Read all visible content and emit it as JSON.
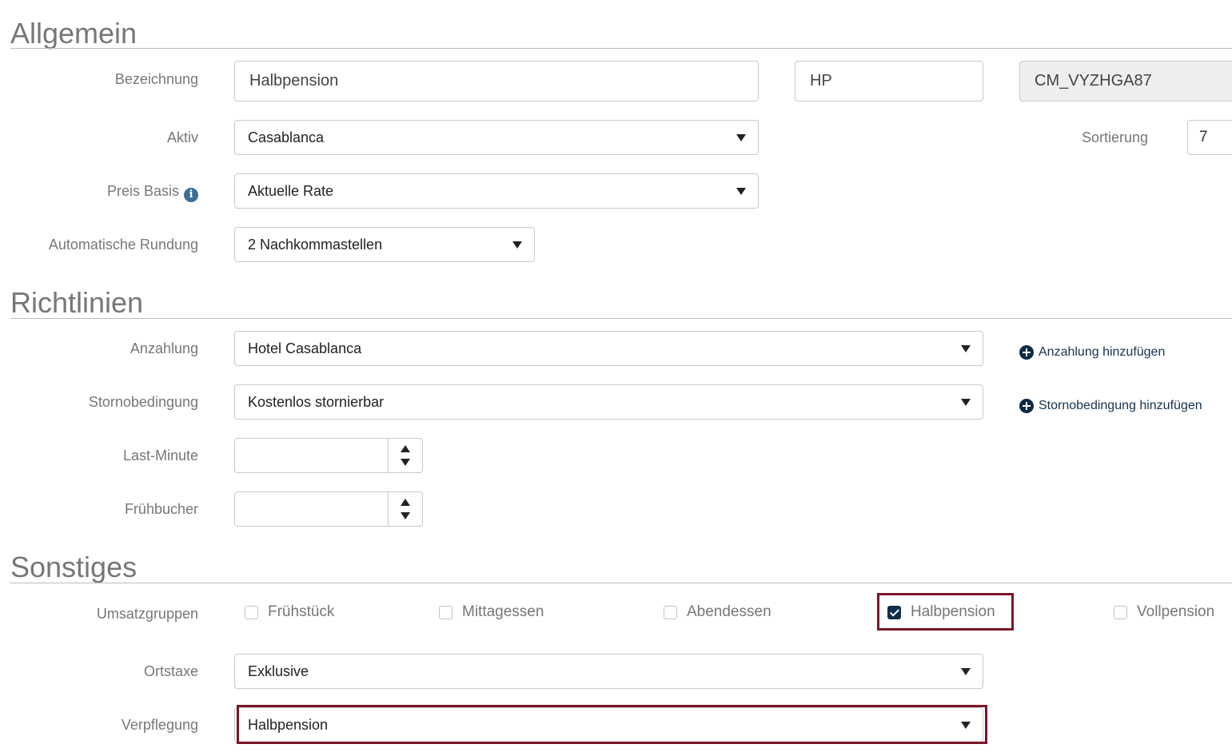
{
  "sections": {
    "allgemein": "Allgemein",
    "richtlinien": "Richtlinien",
    "sonstiges": "Sonstiges"
  },
  "allgemein": {
    "bezeichnung_label": "Bezeichnung",
    "bezeichnung_value": "Halbpension",
    "kurz_value": "HP",
    "code_value": "CM_VYZHGA87",
    "aktiv_label": "Aktiv",
    "aktiv_value": "Casablanca",
    "sortierung_label": "Sortierung",
    "sortierung_value": "7",
    "preis_basis_label": "Preis Basis",
    "preis_basis_value": "Aktuelle Rate",
    "rundung_label": "Automatische Rundung",
    "rundung_value": "2 Nachkommastellen"
  },
  "richtlinien": {
    "anzahlung_label": "Anzahlung",
    "anzahlung_value": "Hotel Casablanca",
    "anzahlung_add": "Anzahlung hinzufügen",
    "storno_label": "Stornobedingung",
    "storno_value": "Kostenlos stornierbar",
    "storno_add": "Stornobedingung hinzufügen",
    "lastminute_label": "Last-Minute",
    "lastminute_value": "",
    "fruehbucher_label": "Frühbucher",
    "fruehbucher_value": ""
  },
  "sonstiges": {
    "umsatzgruppen_label": "Umsatzgruppen",
    "umsatzgruppen": [
      {
        "label": "Frühstück",
        "checked": false
      },
      {
        "label": "Mittagessen",
        "checked": false
      },
      {
        "label": "Abendessen",
        "checked": false
      },
      {
        "label": "Halbpension",
        "checked": true
      },
      {
        "label": "Vollpension",
        "checked": false
      }
    ],
    "ortstaxe_label": "Ortstaxe",
    "ortstaxe_value": "Exklusive",
    "verpflegung_label": "Verpflegung",
    "verpflegung_value": "Halbpension"
  },
  "colors": {
    "highlight": "#7b1526",
    "checkbox_checked": "#102e4a",
    "link": "#15324f"
  },
  "icons": {
    "info": "info-icon",
    "add": "plus-circle-icon",
    "dropdown": "caret-down-icon"
  }
}
